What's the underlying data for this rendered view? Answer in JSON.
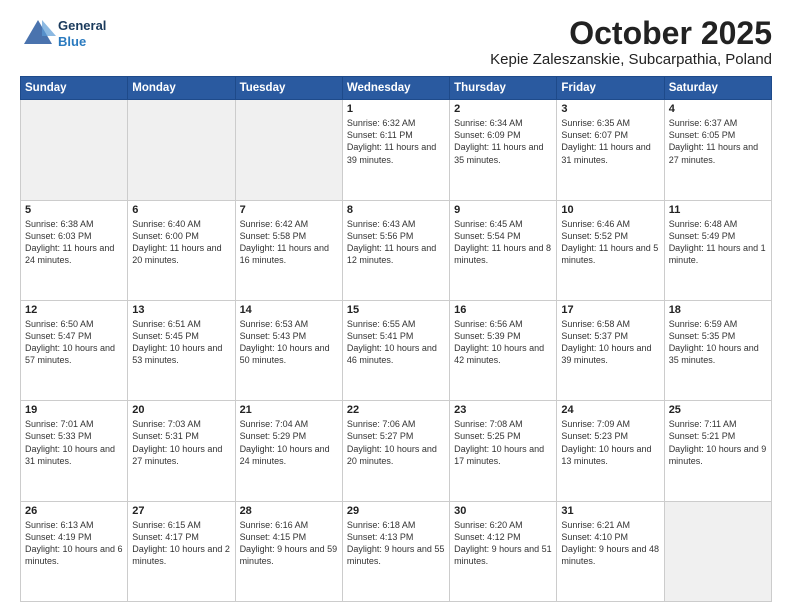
{
  "header": {
    "logo_line1": "General",
    "logo_line2": "Blue",
    "month": "October 2025",
    "location": "Kepie Zaleszanskie, Subcarpathia, Poland"
  },
  "weekdays": [
    "Sunday",
    "Monday",
    "Tuesday",
    "Wednesday",
    "Thursday",
    "Friday",
    "Saturday"
  ],
  "weeks": [
    [
      {
        "day": "",
        "content": ""
      },
      {
        "day": "",
        "content": ""
      },
      {
        "day": "",
        "content": ""
      },
      {
        "day": "1",
        "content": "Sunrise: 6:32 AM\nSunset: 6:11 PM\nDaylight: 11 hours\nand 39 minutes."
      },
      {
        "day": "2",
        "content": "Sunrise: 6:34 AM\nSunset: 6:09 PM\nDaylight: 11 hours\nand 35 minutes."
      },
      {
        "day": "3",
        "content": "Sunrise: 6:35 AM\nSunset: 6:07 PM\nDaylight: 11 hours\nand 31 minutes."
      },
      {
        "day": "4",
        "content": "Sunrise: 6:37 AM\nSunset: 6:05 PM\nDaylight: 11 hours\nand 27 minutes."
      }
    ],
    [
      {
        "day": "5",
        "content": "Sunrise: 6:38 AM\nSunset: 6:03 PM\nDaylight: 11 hours\nand 24 minutes."
      },
      {
        "day": "6",
        "content": "Sunrise: 6:40 AM\nSunset: 6:00 PM\nDaylight: 11 hours\nand 20 minutes."
      },
      {
        "day": "7",
        "content": "Sunrise: 6:42 AM\nSunset: 5:58 PM\nDaylight: 11 hours\nand 16 minutes."
      },
      {
        "day": "8",
        "content": "Sunrise: 6:43 AM\nSunset: 5:56 PM\nDaylight: 11 hours\nand 12 minutes."
      },
      {
        "day": "9",
        "content": "Sunrise: 6:45 AM\nSunset: 5:54 PM\nDaylight: 11 hours\nand 8 minutes."
      },
      {
        "day": "10",
        "content": "Sunrise: 6:46 AM\nSunset: 5:52 PM\nDaylight: 11 hours\nand 5 minutes."
      },
      {
        "day": "11",
        "content": "Sunrise: 6:48 AM\nSunset: 5:49 PM\nDaylight: 11 hours\nand 1 minute."
      }
    ],
    [
      {
        "day": "12",
        "content": "Sunrise: 6:50 AM\nSunset: 5:47 PM\nDaylight: 10 hours\nand 57 minutes."
      },
      {
        "day": "13",
        "content": "Sunrise: 6:51 AM\nSunset: 5:45 PM\nDaylight: 10 hours\nand 53 minutes."
      },
      {
        "day": "14",
        "content": "Sunrise: 6:53 AM\nSunset: 5:43 PM\nDaylight: 10 hours\nand 50 minutes."
      },
      {
        "day": "15",
        "content": "Sunrise: 6:55 AM\nSunset: 5:41 PM\nDaylight: 10 hours\nand 46 minutes."
      },
      {
        "day": "16",
        "content": "Sunrise: 6:56 AM\nSunset: 5:39 PM\nDaylight: 10 hours\nand 42 minutes."
      },
      {
        "day": "17",
        "content": "Sunrise: 6:58 AM\nSunset: 5:37 PM\nDaylight: 10 hours\nand 39 minutes."
      },
      {
        "day": "18",
        "content": "Sunrise: 6:59 AM\nSunset: 5:35 PM\nDaylight: 10 hours\nand 35 minutes."
      }
    ],
    [
      {
        "day": "19",
        "content": "Sunrise: 7:01 AM\nSunset: 5:33 PM\nDaylight: 10 hours\nand 31 minutes."
      },
      {
        "day": "20",
        "content": "Sunrise: 7:03 AM\nSunset: 5:31 PM\nDaylight: 10 hours\nand 27 minutes."
      },
      {
        "day": "21",
        "content": "Sunrise: 7:04 AM\nSunset: 5:29 PM\nDaylight: 10 hours\nand 24 minutes."
      },
      {
        "day": "22",
        "content": "Sunrise: 7:06 AM\nSunset: 5:27 PM\nDaylight: 10 hours\nand 20 minutes."
      },
      {
        "day": "23",
        "content": "Sunrise: 7:08 AM\nSunset: 5:25 PM\nDaylight: 10 hours\nand 17 minutes."
      },
      {
        "day": "24",
        "content": "Sunrise: 7:09 AM\nSunset: 5:23 PM\nDaylight: 10 hours\nand 13 minutes."
      },
      {
        "day": "25",
        "content": "Sunrise: 7:11 AM\nSunset: 5:21 PM\nDaylight: 10 hours\nand 9 minutes."
      }
    ],
    [
      {
        "day": "26",
        "content": "Sunrise: 6:13 AM\nSunset: 4:19 PM\nDaylight: 10 hours\nand 6 minutes."
      },
      {
        "day": "27",
        "content": "Sunrise: 6:15 AM\nSunset: 4:17 PM\nDaylight: 10 hours\nand 2 minutes."
      },
      {
        "day": "28",
        "content": "Sunrise: 6:16 AM\nSunset: 4:15 PM\nDaylight: 9 hours\nand 59 minutes."
      },
      {
        "day": "29",
        "content": "Sunrise: 6:18 AM\nSunset: 4:13 PM\nDaylight: 9 hours\nand 55 minutes."
      },
      {
        "day": "30",
        "content": "Sunrise: 6:20 AM\nSunset: 4:12 PM\nDaylight: 9 hours\nand 51 minutes."
      },
      {
        "day": "31",
        "content": "Sunrise: 6:21 AM\nSunset: 4:10 PM\nDaylight: 9 hours\nand 48 minutes."
      },
      {
        "day": "",
        "content": ""
      }
    ]
  ]
}
